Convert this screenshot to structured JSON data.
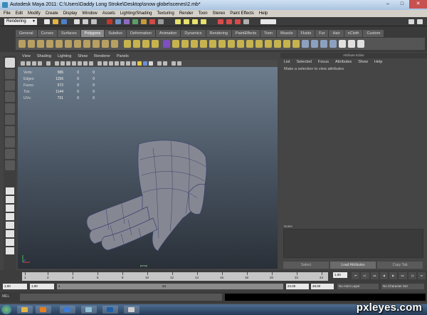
{
  "window": {
    "title": "Autodesk Maya 2011: C:\\Users\\Daddy Long Stroke\\Desktop\\snow globe\\scenes\\2.mb*",
    "minimize_icon": "minimize-icon",
    "maximize_icon": "maximize-icon",
    "close_icon": "close-icon"
  },
  "menubar": [
    "File",
    "Edit",
    "Modify",
    "Create",
    "Display",
    "Window",
    "Assets",
    "Lighting/Shading",
    "Texturing",
    "Render",
    "Toon",
    "Stereo",
    "Paint Effects",
    "Help"
  ],
  "status_line": {
    "mode": "Rendering"
  },
  "shelf": {
    "tabs": [
      "General",
      "Curves",
      "Surfaces",
      "Polygons",
      "Subdivs",
      "Deformation",
      "Animation",
      "Dynamics",
      "Rendering",
      "PaintEffects",
      "Toon",
      "Muscle",
      "Fluids",
      "Fur",
      "Hair",
      "nCloth",
      "Custom"
    ],
    "active_tab": "Polygons"
  },
  "panel": {
    "menu": [
      "View",
      "Shading",
      "Lighting",
      "Show",
      "Renderer",
      "Panels"
    ]
  },
  "hud": [
    {
      "label": "Verts:",
      "vals": [
        "586",
        "0",
        "0"
      ]
    },
    {
      "label": "Edges:",
      "vals": [
        "1156",
        "0",
        "0"
      ]
    },
    {
      "label": "Faces:",
      "vals": [
        "572",
        "0",
        "0"
      ]
    },
    {
      "label": "Tris:",
      "vals": [
        "1144",
        "0",
        "0"
      ]
    },
    {
      "label": "UVs:",
      "vals": [
        "731",
        "0",
        "0"
      ]
    }
  ],
  "viewport": {
    "camera": "persp"
  },
  "attribute_editor": {
    "title": "Attribute Editor",
    "menu": [
      "List",
      "Selected",
      "Focus",
      "Attributes",
      "Show",
      "Help"
    ],
    "message": "Make a selection to view attributes",
    "notes_label": "Notes",
    "buttons": {
      "select": "Select",
      "load": "Load Attributes",
      "copy": "Copy Tab"
    }
  },
  "time_slider": {
    "ticks": [
      "1",
      "2",
      "4",
      "6",
      "8",
      "10",
      "12",
      "14",
      "16",
      "18",
      "20",
      "22",
      "24"
    ],
    "current_frame": "1.00",
    "playback_icons": [
      "skip-to-start-icon",
      "step-back-icon",
      "step-back-key-icon",
      "play-back-icon",
      "play-forward-icon",
      "step-forward-key-icon",
      "step-forward-icon",
      "skip-to-end-icon"
    ]
  },
  "range_slider": {
    "start": "1.00",
    "playback_start": "1.00",
    "slider_start": "1",
    "slider_end": "24",
    "playback_end": "24.00",
    "end": "48.00",
    "anim_layer": "No Anim Layer",
    "character_set": "No Character Set"
  },
  "command_line": {
    "label": "MEL"
  },
  "watermark": "pxleyes.com"
}
